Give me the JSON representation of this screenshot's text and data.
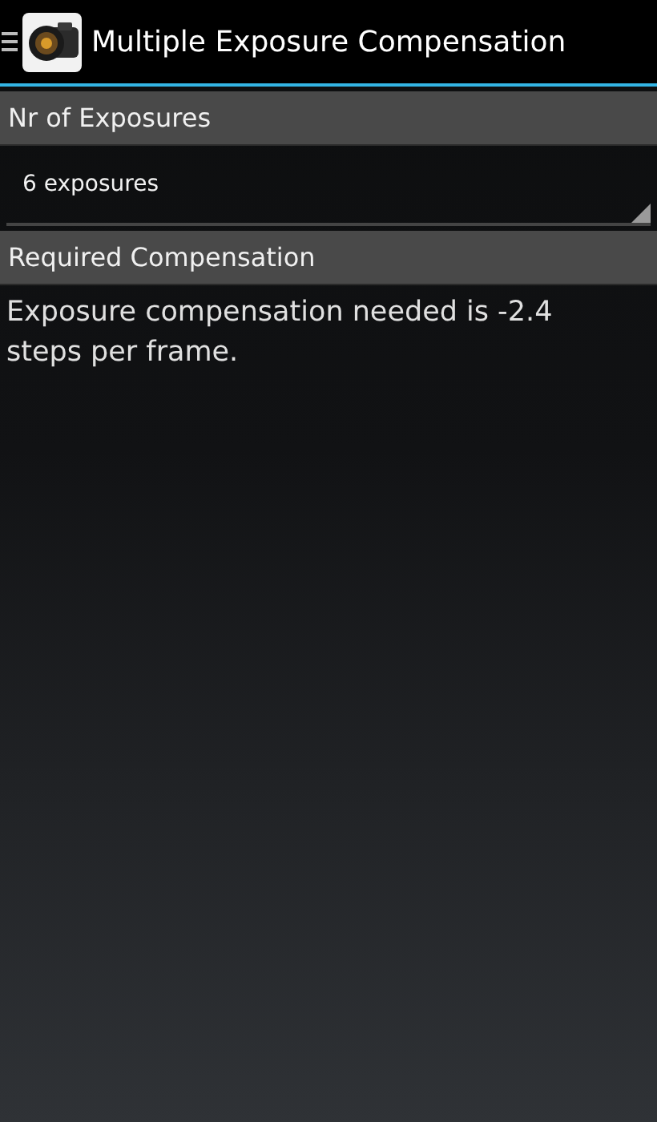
{
  "action_bar": {
    "title": "Multiple Exposure Compensation"
  },
  "sections": [
    {
      "kind": "spinner",
      "header": "Nr of Exposures",
      "value": "6 exposures"
    },
    {
      "kind": "text",
      "header": "Required Compensation",
      "body": "Exposure compensation needed is -2.4 steps per frame."
    }
  ]
}
